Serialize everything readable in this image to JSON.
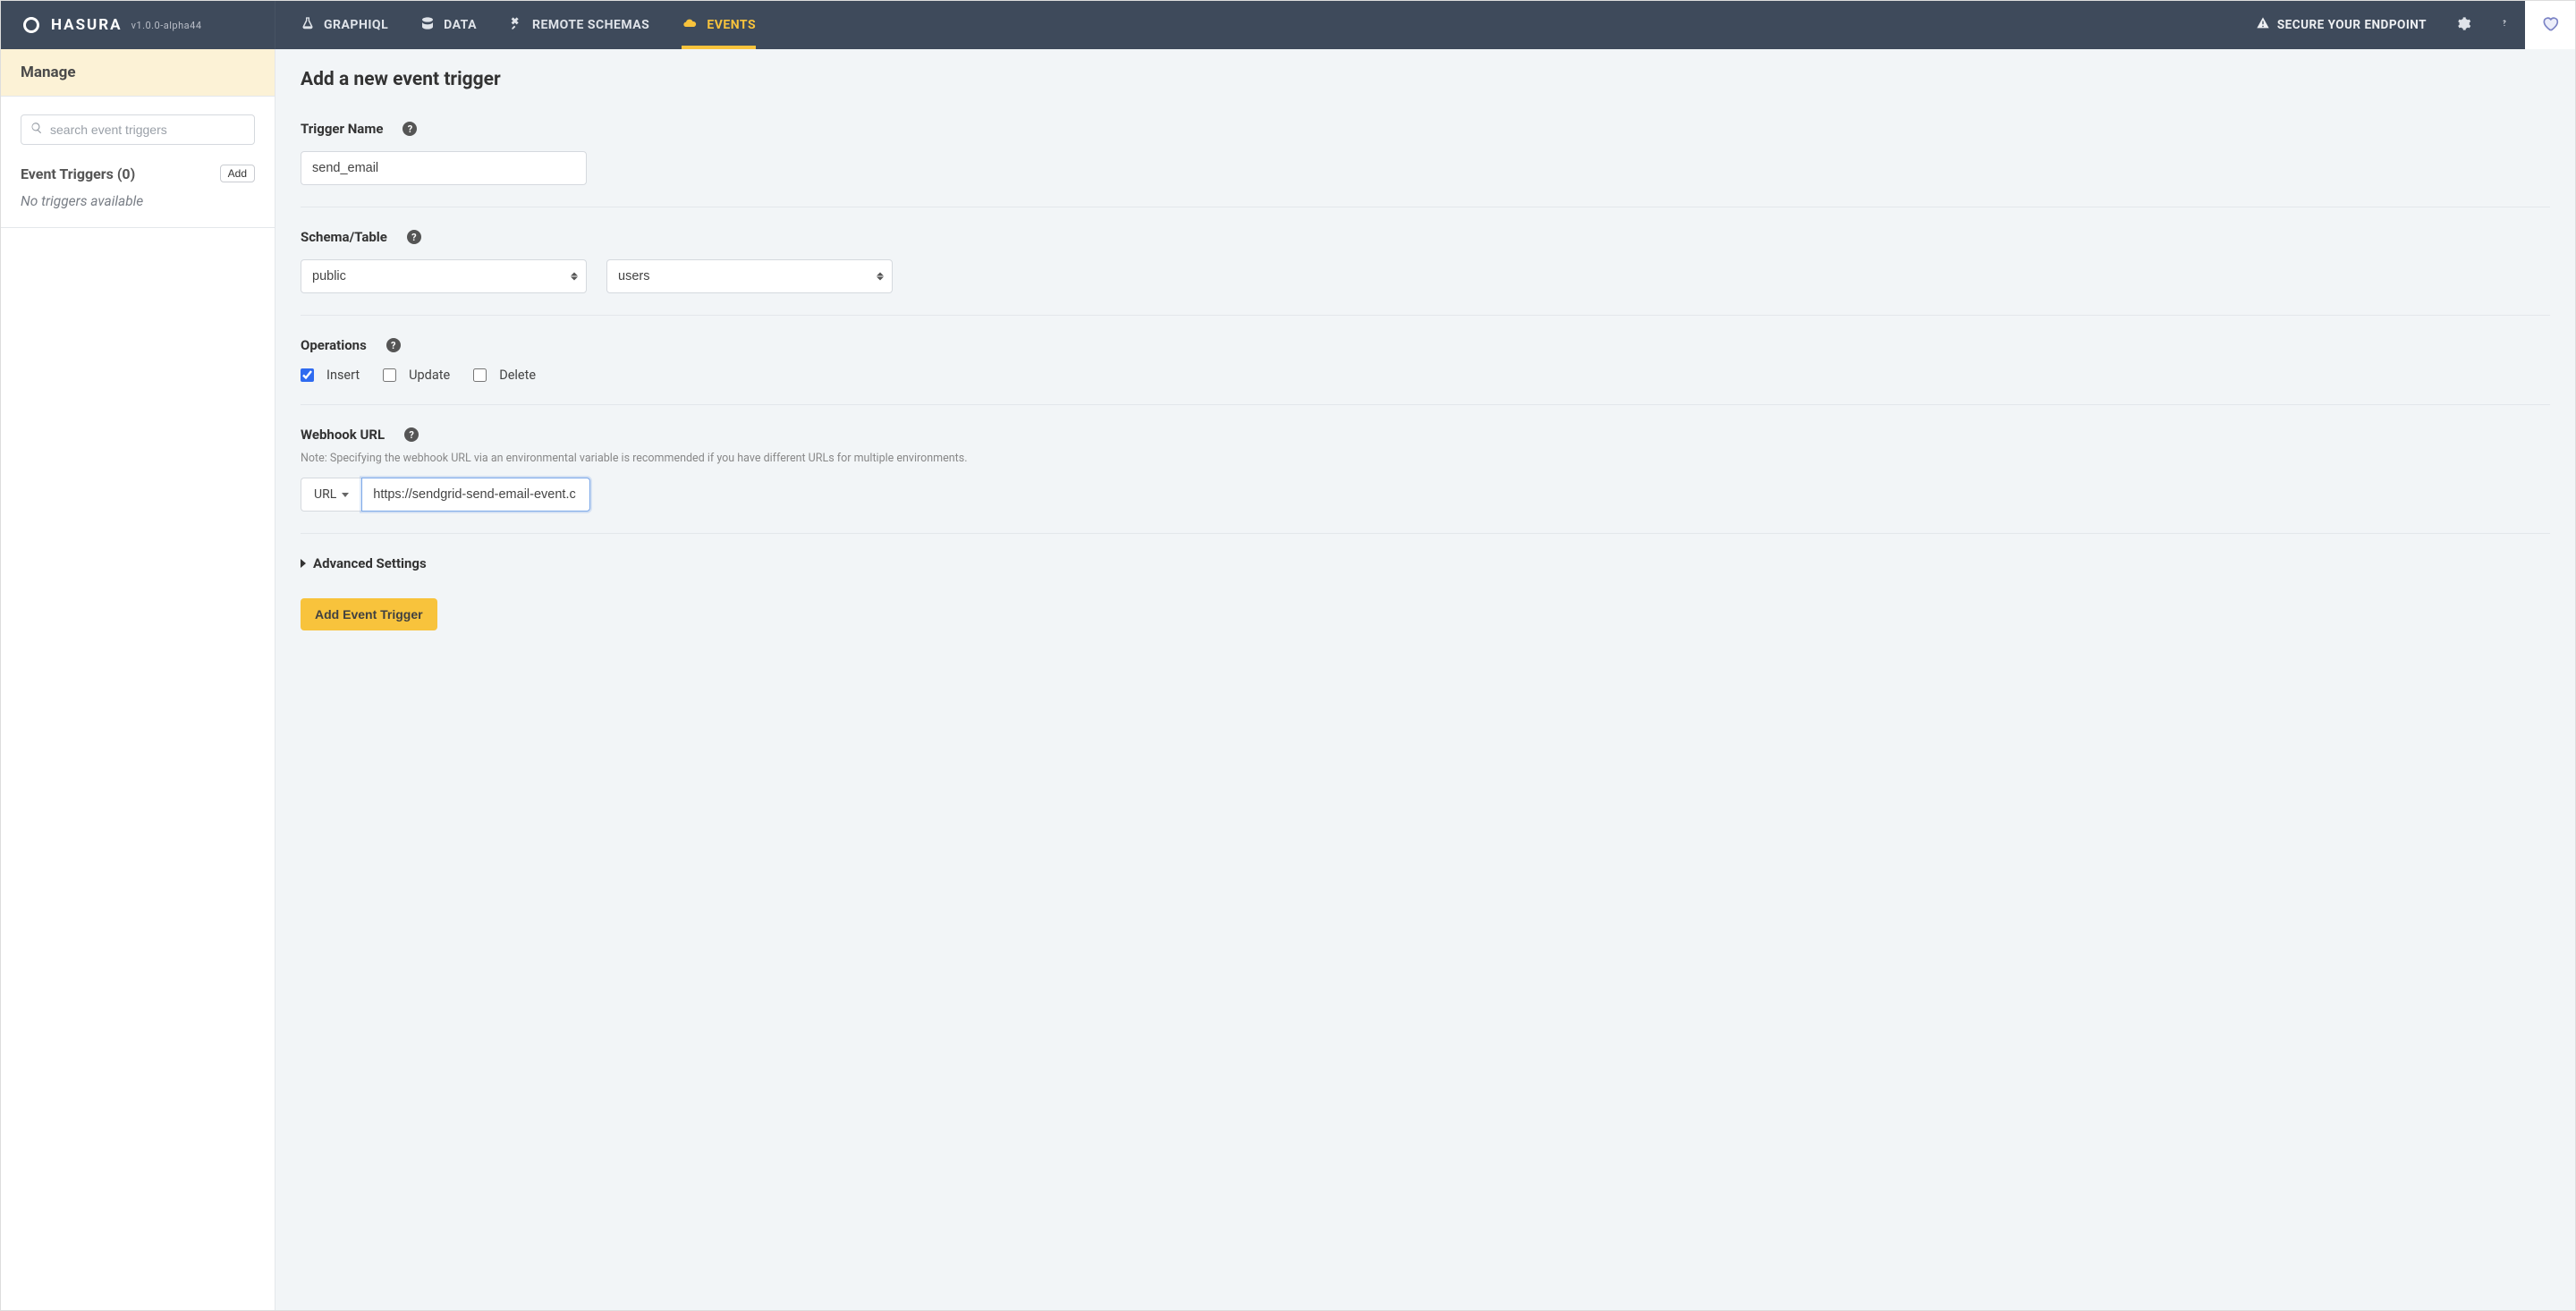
{
  "brand": {
    "name": "HASURA",
    "version": "v1.0.0-alpha44"
  },
  "nav": {
    "graphiql": "GRAPHIQL",
    "data": "DATA",
    "remote_schemas": "REMOTE SCHEMAS",
    "events": "EVENTS",
    "secure": "SECURE YOUR ENDPOINT"
  },
  "sidebar": {
    "manage": "Manage",
    "search_placeholder": "search event triggers",
    "triggers_header": "Event Triggers (0)",
    "add_label": "Add",
    "empty": "No triggers available"
  },
  "page": {
    "title": "Add a new event trigger",
    "trigger_name_label": "Trigger Name",
    "trigger_name_value": "send_email",
    "schema_table_label": "Schema/Table",
    "schema_value": "public",
    "table_value": "users",
    "operations_label": "Operations",
    "op_insert": "Insert",
    "op_update": "Update",
    "op_delete": "Delete",
    "webhook_label": "Webhook URL",
    "webhook_note": "Note: Specifying the webhook URL via an environmental variable is recommended if you have different URLs for multiple environments.",
    "url_type_label": "URL",
    "webhook_value": "https://sendgrid-send-email-event.c",
    "advanced_label": "Advanced Settings",
    "submit_label": "Add Event Trigger"
  }
}
